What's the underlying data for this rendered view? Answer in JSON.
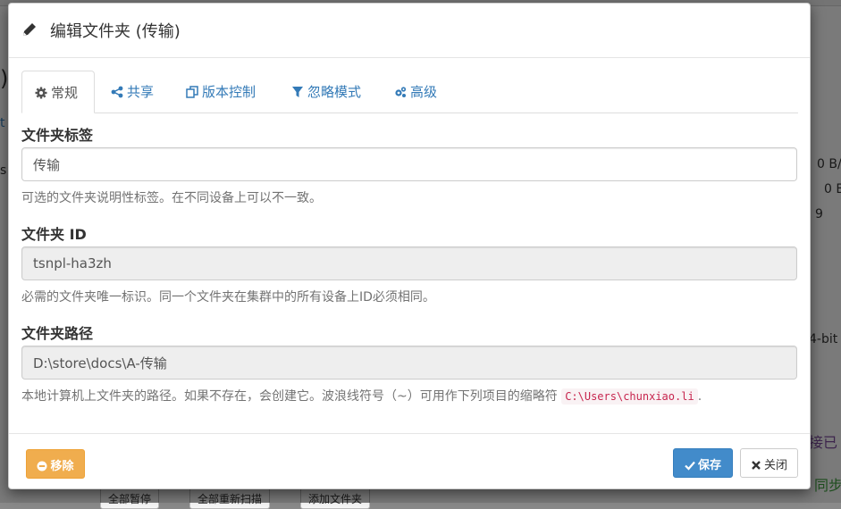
{
  "background": {
    "fragments": [
      ")",
      "t",
      "s",
      "0 B/",
      "0 B",
      "9",
      "4-bit",
      "接已",
      "同步"
    ],
    "buttons": [
      "全部暂停",
      "全部重新扫描",
      "添加文件夹"
    ]
  },
  "modal": {
    "title": "编辑文件夹 (传输)",
    "tabs": [
      {
        "label": "常规",
        "icon": "gear-icon",
        "active": true
      },
      {
        "label": "共享",
        "icon": "share-icon",
        "active": false
      },
      {
        "label": "版本控制",
        "icon": "copy-icon",
        "active": false
      },
      {
        "label": "忽略模式",
        "icon": "filter-icon",
        "active": false
      },
      {
        "label": "高级",
        "icon": "cogs-icon",
        "active": false
      }
    ],
    "fields": {
      "label": {
        "title": "文件夹标签",
        "value": "传输",
        "help": "可选的文件夹说明性标签。在不同设备上可以不一致。"
      },
      "id": {
        "title": "文件夹 ID",
        "value": "tsnpl-ha3zh",
        "help": "必需的文件夹唯一标识。同一个文件夹在集群中的所有设备上ID必须相同。"
      },
      "path": {
        "title": "文件夹路径",
        "value": "D:\\store\\docs\\A-传输",
        "help_prefix": "本地计算机上文件夹的路径。如果不存在，会创建它。波浪线符号（~）可用作下列项目的缩略符",
        "help_code": "C:\\Users\\chunxiao.li",
        "help_suffix": "."
      }
    },
    "footer": {
      "remove_label": "移除",
      "save_label": "保存",
      "close_label": "关闭"
    }
  }
}
